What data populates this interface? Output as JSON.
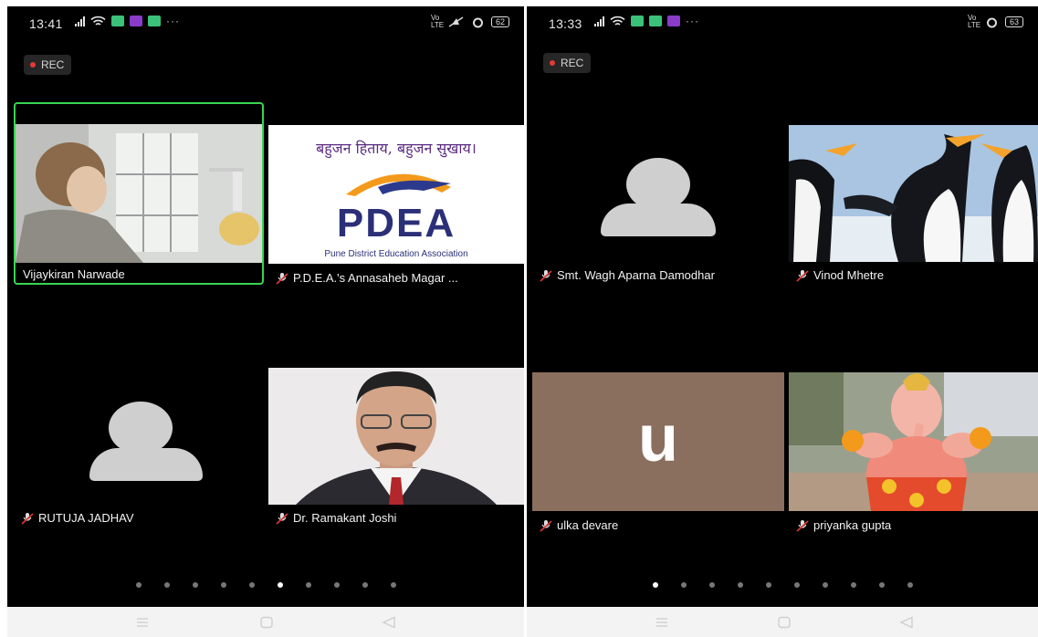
{
  "left_screen": {
    "status": {
      "time": "13:41",
      "battery": "62",
      "overflow": "···"
    },
    "rec_label": "REC",
    "tiles": [
      {
        "name": "Vijaykiran Narwade",
        "muted": false,
        "active": true
      },
      {
        "name": "P.D.E.A.'s Annasaheb Magar ...",
        "muted": true,
        "logo": {
          "motto": "बहुजन हिताय, बहुजन सुखाय।",
          "acronym": "PDEA",
          "full_name": "Pune District Education Association"
        }
      },
      {
        "name": "RUTUJA JADHAV",
        "muted": true
      },
      {
        "name": "Dr. Ramakant Joshi",
        "muted": true
      }
    ],
    "page_count": 10,
    "current_page": 5
  },
  "right_screen": {
    "status": {
      "time": "13:33",
      "battery": "63",
      "overflow": "···"
    },
    "rec_label": "REC",
    "tiles": [
      {
        "name": "Smt. Wagh Aparna Damodhar",
        "muted": true
      },
      {
        "name": "Vinod Mhetre",
        "muted": true
      },
      {
        "name": "ulka devare",
        "muted": true,
        "initial": "u",
        "avatar_color": "#8a6e5e"
      },
      {
        "name": "priyanka gupta",
        "muted": true
      }
    ],
    "page_count": 10,
    "current_page": 0
  },
  "colors": {
    "active_speaker": "#39d353",
    "rec_dot": "#e53935",
    "background": "#000000"
  }
}
